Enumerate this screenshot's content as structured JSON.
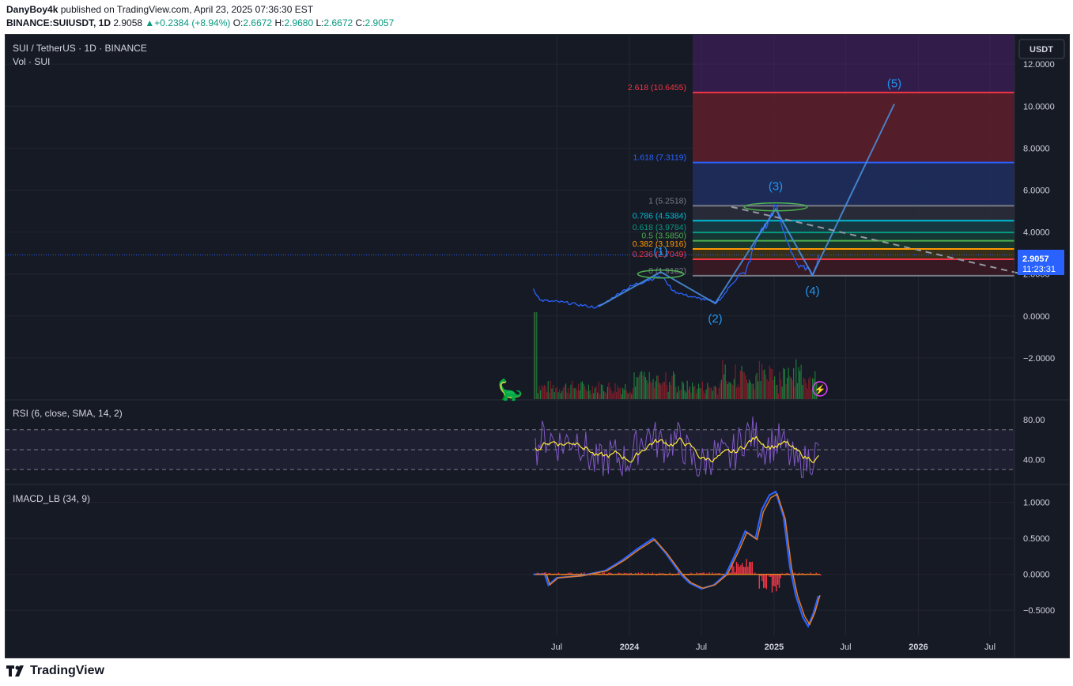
{
  "header": {
    "publisher": "DanyBoy4k",
    "published_line": "published on TradingView.com, April 23, 2025 07:36:30 EST",
    "symbol": "BINANCE:SUIUSDT, 1D",
    "last": "2.9058",
    "change": "+0.2384 (+8.94%)",
    "o_label": "O:",
    "o": "2.6672",
    "h_label": "H:",
    "h": "2.9680",
    "l_label": "L:",
    "l": "2.6672",
    "c_label": "C:",
    "c": "2.9057"
  },
  "main_pane": {
    "title": "SUI / TetherUS · 1D · BINANCE",
    "vol_label": "Vol · SUI",
    "currency_badge": "USDT",
    "price_badge": "2.9057",
    "countdown": "11:23:31"
  },
  "rsi_pane": {
    "title": "RSI (6, close, SMA, 14, 2)"
  },
  "macd_pane": {
    "title": "IMACD_LB (34, 9)"
  },
  "footer": {
    "brand": "TradingView"
  },
  "colors": {
    "background": "#161a25",
    "price_line": "#2962ff",
    "fib_red": "#f23645",
    "fib_blue": "#2962ff",
    "fib_cyan": "#00bcd4",
    "fib_orange": "#ff9800",
    "fib_gray": "#787b86",
    "wave_label": "#2196f3",
    "rsi": "#7e57c2",
    "rsi_ma": "#ffeb3b",
    "macd_hist": "#f23645",
    "macd_line": "#e67e22"
  },
  "chart_data": [
    {
      "type": "line",
      "pane": "price",
      "x_tick_labels": [
        "Jul",
        "2024",
        "Jul",
        "2025",
        "Jul",
        "2026",
        "Jul"
      ],
      "y_ticks": [
        "12.0000",
        "10.0000",
        "8.0000",
        "6.0000",
        "4.0000",
        "2.0000",
        "0.0000",
        "−2.0000"
      ],
      "ylim": [
        -4,
        13.4
      ],
      "series": [
        {
          "values": [
            {
              "x": "2023-05-03",
              "y": 1.3
            },
            {
              "x": "2023-05-20",
              "y": 0.75
            },
            {
              "x": "2023-06-15",
              "y": 0.7
            },
            {
              "x": "2023-07-20",
              "y": 0.65
            },
            {
              "x": "2023-08-20",
              "y": 0.55
            },
            {
              "x": "2023-09-15",
              "y": 0.47
            },
            {
              "x": "2023-10-10",
              "y": 0.42
            },
            {
              "x": "2023-10-25",
              "y": 0.55
            },
            {
              "x": "2023-11-15",
              "y": 0.8
            },
            {
              "x": "2023-12-15",
              "y": 1.2
            },
            {
              "x": "2024-01-15",
              "y": 1.5
            },
            {
              "x": "2024-02-15",
              "y": 1.7
            },
            {
              "x": "2024-03-15",
              "y": 1.9
            },
            {
              "x": "2024-04-01",
              "y": 1.7
            },
            {
              "x": "2024-04-20",
              "y": 1.2
            },
            {
              "x": "2024-05-20",
              "y": 1.0
            },
            {
              "x": "2024-06-20",
              "y": 0.85
            },
            {
              "x": "2024-07-20",
              "y": 0.75
            },
            {
              "x": "2024-08-05",
              "y": 0.6
            },
            {
              "x": "2024-08-25",
              "y": 0.95
            },
            {
              "x": "2024-09-15",
              "y": 1.5
            },
            {
              "x": "2024-10-05",
              "y": 2.0
            },
            {
              "x": "2024-10-20",
              "y": 2.0
            },
            {
              "x": "2024-11-10",
              "y": 3.2
            },
            {
              "x": "2024-12-01",
              "y": 4.2
            },
            {
              "x": "2024-12-15",
              "y": 4.3
            },
            {
              "x": "2024-12-25",
              "y": 4.9
            },
            {
              "x": "2025-01-05",
              "y": 5.25
            },
            {
              "x": "2025-01-20",
              "y": 4.3
            },
            {
              "x": "2025-02-05",
              "y": 3.5
            },
            {
              "x": "2025-02-20",
              "y": 2.8
            },
            {
              "x": "2025-03-05",
              "y": 2.3
            },
            {
              "x": "2025-03-25",
              "y": 2.3
            },
            {
              "x": "2025-04-08",
              "y": 1.95
            },
            {
              "x": "2025-04-15",
              "y": 2.3
            },
            {
              "x": "2025-04-23",
              "y": 2.9
            }
          ]
        }
      ]
    },
    {
      "type": "fibonacci",
      "pane": "price",
      "levels": [
        {
          "ratio": "2.618",
          "price": "10.6455",
          "label": "2.618 (10.6455)",
          "color": "#f23645"
        },
        {
          "ratio": "1.618",
          "price": "7.3119",
          "label": "1.618 (7.3119)",
          "color": "#2962ff"
        },
        {
          "ratio": "1",
          "price": "5.2518",
          "label": "1 (5.2518)",
          "color": "#787b86"
        },
        {
          "ratio": "0.786",
          "price": "4.5384",
          "label": "0.786 (4.5384)",
          "color": "#00bcd4"
        },
        {
          "ratio": "0.618",
          "price": "3.9784",
          "label": "0.618 (3.9784)",
          "color": "#089981"
        },
        {
          "ratio": "0.5",
          "price": "3.5850",
          "label": "0.5 (3.5850)",
          "color": "#4caf50"
        },
        {
          "ratio": "0.382",
          "price": "3.1916",
          "label": "0.382 (3.1916)",
          "color": "#ff9800"
        },
        {
          "ratio": "0.236",
          "price": "2.7049",
          "label": "0.236 (2.7049)",
          "color": "#f23645"
        },
        {
          "ratio": "0",
          "price": "1.9182",
          "label": "0 (1.9182)",
          "color": "#787b86"
        }
      ]
    },
    {
      "type": "annotations",
      "pane": "price",
      "elliott_waves": [
        {
          "label": "(1)",
          "x": "2024-03-20",
          "y": 2.9
        },
        {
          "label": "(2)",
          "x": "2024-08-05",
          "y": -0.3
        },
        {
          "label": "(3)",
          "x": "2025-01-05",
          "y": 6.0
        },
        {
          "label": "(4)",
          "x": "2025-04-08",
          "y": 1.0
        },
        {
          "label": "(5)",
          "x": "2025-11-01",
          "y": 10.9
        }
      ],
      "wave_path": [
        {
          "x": "2023-10-15",
          "y": 0.45
        },
        {
          "x": "2024-03-20",
          "y": 2.1
        },
        {
          "x": "2024-08-05",
          "y": 0.6
        },
        {
          "x": "2025-01-05",
          "y": 5.1
        },
        {
          "x": "2025-04-08",
          "y": 1.95
        },
        {
          "x": "2025-11-01",
          "y": 10.1
        }
      ],
      "trendline": [
        {
          "x": "2024-09-15",
          "y": 5.2
        },
        {
          "x": "2026-09-20",
          "y": 2.0
        }
      ]
    },
    {
      "type": "bar",
      "pane": "volume",
      "description_series": "Vol · SUI"
    },
    {
      "type": "line",
      "pane": "rsi",
      "y_ticks": [
        "80.00",
        "40.00"
      ],
      "bands": [
        70,
        50,
        30
      ],
      "ylim": [
        15,
        100
      ]
    },
    {
      "type": "line",
      "pane": "macd",
      "y_ticks": [
        "1.0000",
        "0.5000",
        "0.0000",
        "−0.5000"
      ],
      "ylim": [
        -0.85,
        1.25
      ],
      "series": [
        {
          "values": [
            {
              "x": "2023-05-03",
              "y": 0.0
            },
            {
              "x": "2023-06-01",
              "y": 0.0
            },
            {
              "x": "2023-06-10",
              "y": -0.15
            },
            {
              "x": "2023-07-01",
              "y": -0.05
            },
            {
              "x": "2023-09-01",
              "y": -0.02
            },
            {
              "x": "2023-11-01",
              "y": 0.05
            },
            {
              "x": "2023-12-15",
              "y": 0.2
            },
            {
              "x": "2024-01-20",
              "y": 0.35
            },
            {
              "x": "2024-03-01",
              "y": 0.5
            },
            {
              "x": "2024-04-01",
              "y": 0.3
            },
            {
              "x": "2024-05-10",
              "y": 0.0
            },
            {
              "x": "2024-06-01",
              "y": -0.12
            },
            {
              "x": "2024-07-01",
              "y": -0.2
            },
            {
              "x": "2024-08-01",
              "y": -0.15
            },
            {
              "x": "2024-09-01",
              "y": 0.0
            },
            {
              "x": "2024-10-01",
              "y": 0.35
            },
            {
              "x": "2024-10-20",
              "y": 0.6
            },
            {
              "x": "2024-11-15",
              "y": 0.5
            },
            {
              "x": "2024-12-01",
              "y": 0.9
            },
            {
              "x": "2024-12-20",
              "y": 1.1
            },
            {
              "x": "2025-01-05",
              "y": 1.15
            },
            {
              "x": "2025-01-25",
              "y": 0.8
            },
            {
              "x": "2025-02-10",
              "y": 0.1
            },
            {
              "x": "2025-02-25",
              "y": -0.3
            },
            {
              "x": "2025-03-15",
              "y": -0.6
            },
            {
              "x": "2025-03-28",
              "y": -0.72
            },
            {
              "x": "2025-04-10",
              "y": -0.55
            },
            {
              "x": "2025-04-23",
              "y": -0.3
            }
          ]
        }
      ]
    }
  ]
}
